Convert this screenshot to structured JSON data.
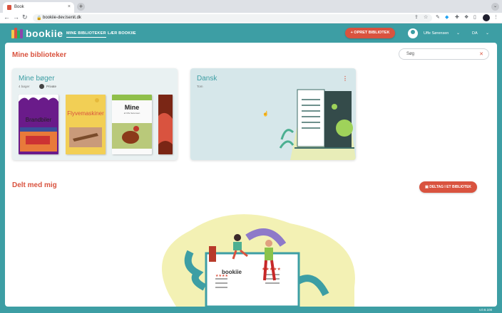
{
  "browser": {
    "tab_title": "Book",
    "tab_close": "×",
    "new_tab": "+",
    "tab_menu": "⌄",
    "url": "bookiie-dev.lsenit.dk"
  },
  "app": {
    "logo_text": "bookiie",
    "nav": [
      "MINE BIBLIOTEKER",
      "LÆR BOOKIIE"
    ],
    "create_button": "+ OPRET BIBLIOTEK",
    "user_name": "Uffe Sørensen",
    "language": "DA"
  },
  "main": {
    "my_libraries_title": "Mine biblioteker",
    "search_placeholder": "Søg",
    "cards": [
      {
        "title": "Mine bøger",
        "meta": "4 bøger",
        "privacy": "Private"
      },
      {
        "title": "Dansk",
        "meta": "Tom"
      }
    ],
    "books": [
      {
        "title": "Brandbiler"
      },
      {
        "title": "Flyvemaskiner"
      },
      {
        "title": "Mine",
        "subtitle": "af Uffe Sørensen"
      }
    ],
    "shared_title": "Delt med mig",
    "join_button": "DELTAG I ET BIBLIOTEK",
    "illustration_logo": "bookiie"
  },
  "footer": {
    "version": "v.0.6.100"
  },
  "colors": {
    "teal": "#3d9ea4",
    "accent": "#d9533f",
    "yellow": "#f3f1b4"
  }
}
